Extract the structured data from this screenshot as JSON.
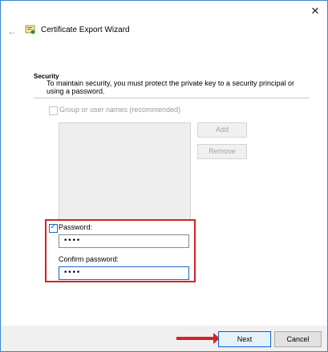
{
  "header": {
    "title": "Certificate Export Wizard",
    "back_icon": "back-arrow-icon",
    "close_icon": "close-icon",
    "app_icon": "certificate-icon"
  },
  "security": {
    "section_title": "Security",
    "description": "To maintain security, you must protect the private key to a security principal or using a password.",
    "group_option_label": "Group or user names (recommended)",
    "group_checked": false,
    "add_label": "Add",
    "remove_label": "Remove",
    "password_checked": true,
    "password_label": "Password:",
    "password_value": "••••",
    "confirm_label": "Confirm password:",
    "confirm_value": "••••"
  },
  "footer": {
    "next_label": "Next",
    "cancel_label": "Cancel"
  },
  "colors": {
    "accent": "#1a66c9",
    "annotation": "#d32226"
  }
}
